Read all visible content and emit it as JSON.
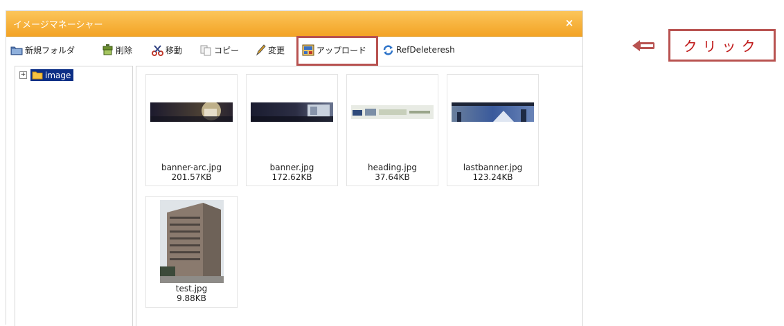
{
  "dialog": {
    "title": "イメージマネーシャー",
    "close_glyph": "×"
  },
  "toolbar": {
    "new_folder": "新規フォルダ",
    "delete": "削除",
    "move": "移動",
    "copy": "コピー",
    "change": "変更",
    "upload": "アップロード",
    "refresh": "RefDeleteresh"
  },
  "tree": {
    "expander": "+",
    "root_label": "image"
  },
  "files": [
    {
      "name": "banner-arc.jpg",
      "size": "201.57KB"
    },
    {
      "name": "banner.jpg",
      "size": "172.62KB"
    },
    {
      "name": "heading.jpg",
      "size": "37.64KB"
    },
    {
      "name": "lastbanner.jpg",
      "size": "123.24KB"
    },
    {
      "name": "test.jpg",
      "size": "9.88KB"
    }
  ],
  "annotation": {
    "text": "クリック",
    "highlight_color": "#b85250",
    "text_color": "#c01a1a"
  },
  "colors": {
    "titlebar": "#f3a325",
    "tree_selection": "#0c2f86"
  }
}
